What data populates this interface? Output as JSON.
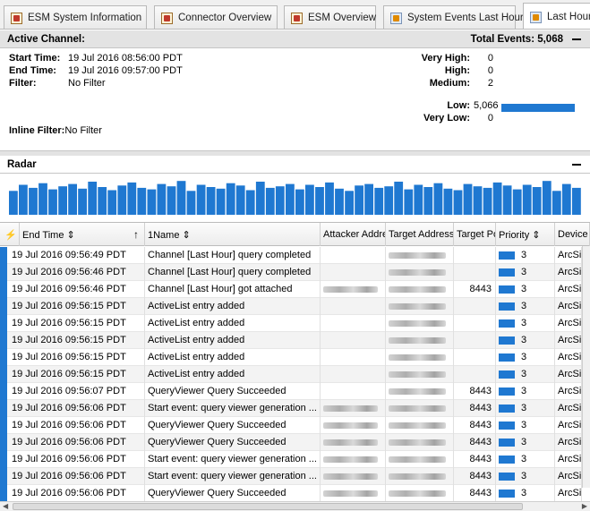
{
  "tabs": [
    {
      "label": "ESM System Information",
      "icon": "dashboard-icon"
    },
    {
      "label": "Connector Overview",
      "icon": "dashboard-icon"
    },
    {
      "label": "ESM Overview",
      "icon": "dashboard-icon"
    },
    {
      "label": "System Events Last Hour",
      "icon": "channel-icon"
    },
    {
      "label": "Last Hour",
      "icon": "channel-icon"
    }
  ],
  "channel": {
    "title": "Active Channel:",
    "total_events": "Total Events: 5,068",
    "start_label": "Start Time:",
    "start_value": "19 Jul 2016 08:56:00 PDT",
    "end_label": "End Time:",
    "end_value": "19 Jul 2016 09:57:00 PDT",
    "filter_label": "Filter:",
    "filter_value": "No Filter",
    "inline_filter_label": "Inline Filter:",
    "inline_filter_value": "No Filter"
  },
  "priorities": [
    {
      "label": "Very High:",
      "value": "0"
    },
    {
      "label": "High:",
      "value": "0"
    },
    {
      "label": "Medium:",
      "value": "2"
    },
    {
      "label": "Low:",
      "value": "5,066"
    },
    {
      "label": "Very Low:",
      "value": "0"
    }
  ],
  "radar": {
    "title": "Radar",
    "bar_color": "#1f78d1",
    "levels": [
      0.62,
      0.78,
      0.7,
      0.82,
      0.66,
      0.74,
      0.8,
      0.68,
      0.86,
      0.72,
      0.64,
      0.76,
      0.84,
      0.7,
      0.66,
      0.8,
      0.74,
      0.88,
      0.62,
      0.78,
      0.72,
      0.68,
      0.82,
      0.76,
      0.64,
      0.86,
      0.7,
      0.74,
      0.8,
      0.66,
      0.78,
      0.72,
      0.84,
      0.68,
      0.62,
      0.76,
      0.8,
      0.7,
      0.74,
      0.86,
      0.66,
      0.78,
      0.72,
      0.82,
      0.68,
      0.64,
      0.8,
      0.74,
      0.7,
      0.84,
      0.76,
      0.66,
      0.78,
      0.72,
      0.88,
      0.62,
      0.8,
      0.7
    ]
  },
  "grid": {
    "columns": [
      "End Time ⇕",
      "1Name ⇕",
      "Attacker Address",
      "Target Address",
      "Target Port",
      "Priority ⇕",
      "Device"
    ],
    "rows": [
      {
        "end_time": "19 Jul 2016 09:56:49 PDT",
        "name": "Channel [Last Hour] query completed",
        "attacker": "",
        "target": "blur",
        "port": "",
        "priority": "3",
        "device": "ArcSight"
      },
      {
        "end_time": "19 Jul 2016 09:56:46 PDT",
        "name": "Channel [Last Hour] query completed",
        "attacker": "",
        "target": "blur",
        "port": "",
        "priority": "3",
        "device": "ArcSight"
      },
      {
        "end_time": "19 Jul 2016 09:56:46 PDT",
        "name": "Channel [Last Hour] got attached",
        "attacker": "blur",
        "target": "blur",
        "port": "8443",
        "priority": "3",
        "device": "ArcSight"
      },
      {
        "end_time": "19 Jul 2016 09:56:15 PDT",
        "name": "ActiveList entry added",
        "attacker": "",
        "target": "blur",
        "port": "",
        "priority": "3",
        "device": "ArcSight"
      },
      {
        "end_time": "19 Jul 2016 09:56:15 PDT",
        "name": "ActiveList entry added",
        "attacker": "",
        "target": "blur",
        "port": "",
        "priority": "3",
        "device": "ArcSight"
      },
      {
        "end_time": "19 Jul 2016 09:56:15 PDT",
        "name": "ActiveList entry added",
        "attacker": "",
        "target": "blur",
        "port": "",
        "priority": "3",
        "device": "ArcSight"
      },
      {
        "end_time": "19 Jul 2016 09:56:15 PDT",
        "name": "ActiveList entry added",
        "attacker": "",
        "target": "blur",
        "port": "",
        "priority": "3",
        "device": "ArcSight"
      },
      {
        "end_time": "19 Jul 2016 09:56:15 PDT",
        "name": "ActiveList entry added",
        "attacker": "",
        "target": "blur",
        "port": "",
        "priority": "3",
        "device": "ArcSight"
      },
      {
        "end_time": "19 Jul 2016 09:56:07 PDT",
        "name": "QueryViewer Query Succeeded",
        "attacker": "",
        "target": "blur",
        "port": "8443",
        "priority": "3",
        "device": "ArcSight"
      },
      {
        "end_time": "19 Jul 2016 09:56:06 PDT",
        "name": "Start event: query viewer generation ...",
        "attacker": "blur",
        "target": "blur",
        "port": "8443",
        "priority": "3",
        "device": "ArcSight"
      },
      {
        "end_time": "19 Jul 2016 09:56:06 PDT",
        "name": "QueryViewer Query Succeeded",
        "attacker": "blur",
        "target": "blur",
        "port": "8443",
        "priority": "3",
        "device": "ArcSight"
      },
      {
        "end_time": "19 Jul 2016 09:56:06 PDT",
        "name": "QueryViewer Query Succeeded",
        "attacker": "blur",
        "target": "blur",
        "port": "8443",
        "priority": "3",
        "device": "ArcSight"
      },
      {
        "end_time": "19 Jul 2016 09:56:06 PDT",
        "name": "Start event: query viewer generation ...",
        "attacker": "blur",
        "target": "blur",
        "port": "8443",
        "priority": "3",
        "device": "ArcSight"
      },
      {
        "end_time": "19 Jul 2016 09:56:06 PDT",
        "name": "Start event: query viewer generation ...",
        "attacker": "blur",
        "target": "blur",
        "port": "8443",
        "priority": "3",
        "device": "ArcSight"
      },
      {
        "end_time": "19 Jul 2016 09:56:06 PDT",
        "name": "QueryViewer Query Succeeded",
        "attacker": "blur",
        "target": "blur",
        "port": "8443",
        "priority": "3",
        "device": "ArcSight"
      }
    ],
    "priority_color": "#1f78d1",
    "marker_color": "#1f78d1"
  }
}
